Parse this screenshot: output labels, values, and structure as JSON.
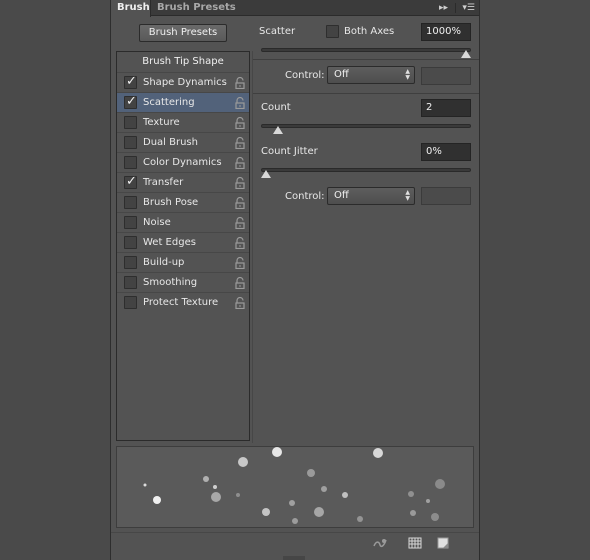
{
  "tabs": [
    {
      "label": "Brush",
      "active": true
    },
    {
      "label": "Brush Presets",
      "active": false
    }
  ],
  "presets_button": "Brush Presets",
  "list": {
    "header": "Brush Tip Shape",
    "items": [
      {
        "label": "Shape Dynamics",
        "checked": true,
        "selected": false
      },
      {
        "label": "Scattering",
        "checked": true,
        "selected": true
      },
      {
        "label": "Texture",
        "checked": false,
        "selected": false
      },
      {
        "label": "Dual Brush",
        "checked": false,
        "selected": false
      },
      {
        "label": "Color Dynamics",
        "checked": false,
        "selected": false
      },
      {
        "label": "Transfer",
        "checked": true,
        "selected": false
      },
      {
        "label": "Brush Pose",
        "checked": false,
        "selected": false
      },
      {
        "label": "Noise",
        "checked": false,
        "selected": false
      },
      {
        "label": "Wet Edges",
        "checked": false,
        "selected": false
      },
      {
        "label": "Build-up",
        "checked": false,
        "selected": false
      },
      {
        "label": "Smoothing",
        "checked": false,
        "selected": false
      },
      {
        "label": "Protect Texture",
        "checked": false,
        "selected": false
      }
    ]
  },
  "scattering": {
    "scatter_label": "Scatter",
    "both_axes_label": "Both Axes",
    "both_axes_checked": false,
    "scatter_value": "1000%",
    "scatter_level": 1.0,
    "control1_label": "Control:",
    "control1_value": "Off",
    "count_label": "Count",
    "count_value": "2",
    "count_level": 0.06,
    "count_jitter_label": "Count Jitter",
    "count_jitter_value": "0%",
    "count_jitter_level": 0.0,
    "control2_label": "Control:",
    "control2_value": "Off"
  },
  "colors": {
    "panel": "#535353",
    "selected_row": "#52627a",
    "input_bg": "#303030"
  },
  "icons": {
    "tab_menu": "panel-menu-icon",
    "lock": "lock-icon",
    "footer": [
      "brush-toggle-icon",
      "grid-icon",
      "new-preset-icon"
    ]
  }
}
